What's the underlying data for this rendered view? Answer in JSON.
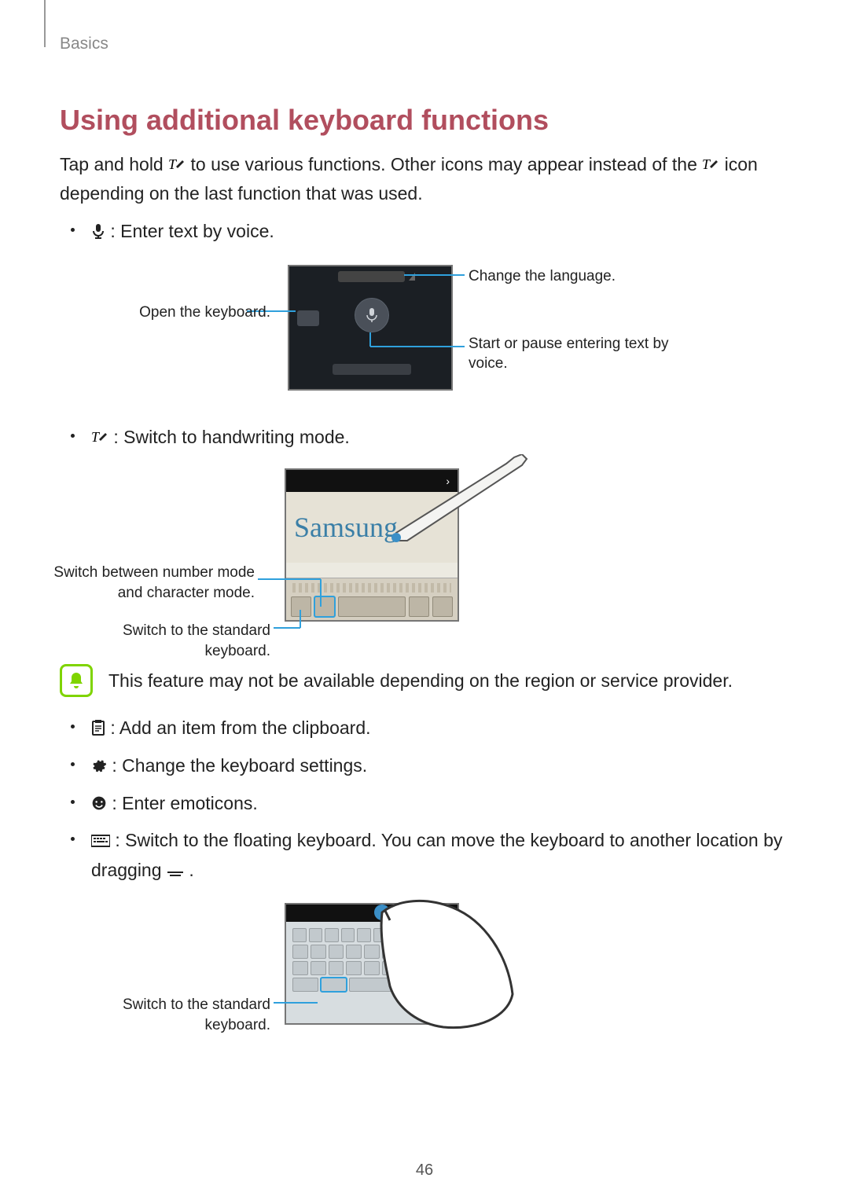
{
  "breadcrumb": "Basics",
  "heading": "Using additional keyboard functions",
  "intro_pre": "Tap and hold ",
  "intro_mid": " to use various functions. Other icons may appear instead of the ",
  "intro_post": " icon depending on the last function that was used.",
  "bullets": {
    "voice": " : Enter text by voice.",
    "handwriting": " : Switch to handwriting mode.",
    "clipboard": " : Add an item from the clipboard.",
    "settings": " : Change the keyboard settings.",
    "emoticons": " : Enter emoticons.",
    "floating_pre": " : Switch to the floating keyboard. You can move the keyboard to another location by dragging ",
    "floating_post": "."
  },
  "callouts": {
    "open_keyboard": "Open the keyboard.",
    "change_language": "Change the language.",
    "start_pause_voice": "Start or pause entering text by voice.",
    "switch_num_char": "Switch between number mode and character mode.",
    "switch_std_kb": "Switch to the standard keyboard.",
    "switch_std_kb2": "Switch to the standard keyboard."
  },
  "handwriting_sample": "Samsung",
  "note_text": "This feature may not be available depending on the region or service provider.",
  "page_number": "46"
}
